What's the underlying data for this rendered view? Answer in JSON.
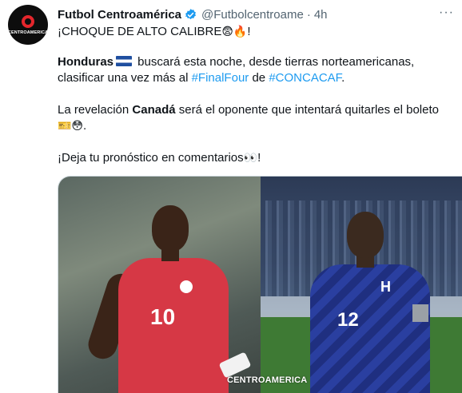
{
  "author": {
    "name": "Futbol Centroamérica",
    "handle": "@Futbolcentroame",
    "separator": "·",
    "time": "4h",
    "avatar_text": "CENTROAMERICA",
    "verified_icon": "verified-badge-icon",
    "verified_color": "#1d9bf0"
  },
  "more_menu": "···",
  "tweet": {
    "line1_text": "¡CHOQUE DE ALTO CALIBRE",
    "line1_emojis": "😨🔥",
    "line1_end": "!",
    "p2_team": "Honduras",
    "p2_text_a": " buscará esta noche, desde tierras norteamericanas, clasificar una vez más al ",
    "p2_link1": "#FinalFour",
    "p2_text_b": " de ",
    "p2_link2": "#CONCACAF",
    "p2_end": ".",
    "p3_text_a": "La revelación ",
    "p3_team": "Canadá",
    "p3_text_b": " será el oponente que intentará quitarles el boleto ",
    "p3_emojis": "🎫😳",
    "p3_end": ".",
    "p4_text": "¡Deja tu pronóstico en comentarios",
    "p4_emojis": "👀",
    "p4_end": "!"
  },
  "media": {
    "left_number": "10",
    "right_number": "12",
    "right_crest": "H",
    "watermark": "CENTROAMERICA"
  },
  "colors": {
    "link": "#1d9bf0",
    "text": "#0f1419",
    "muted": "#536471",
    "canada_red": "#d63845",
    "honduras_blue": "#2a3fa0"
  }
}
